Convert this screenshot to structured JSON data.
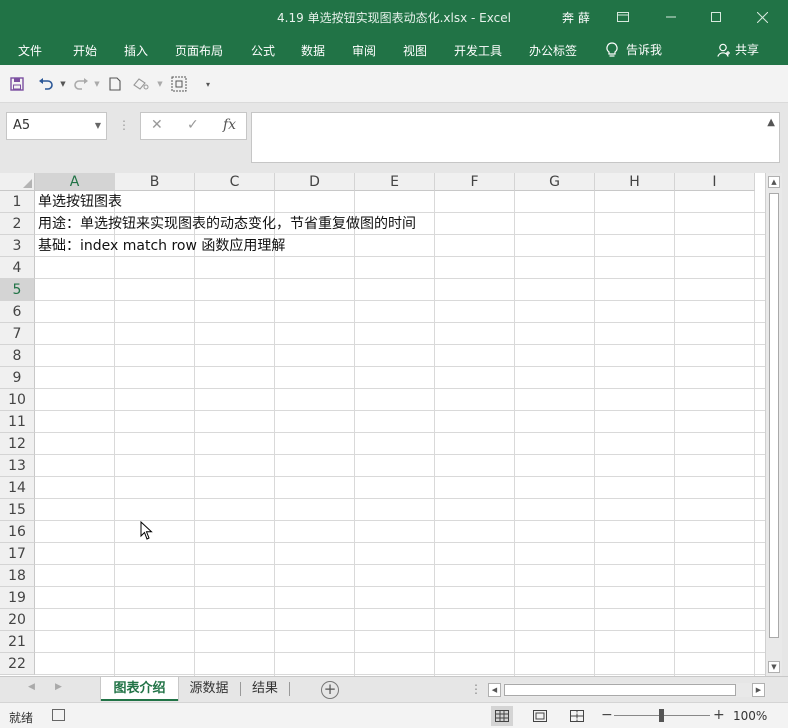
{
  "window": {
    "title": "4.19 单选按钮实现图表动态化.xlsx  -  Excel",
    "user": "奔 薛"
  },
  "ribbon": {
    "tabs": [
      "文件",
      "开始",
      "插入",
      "页面布局",
      "公式",
      "数据",
      "审阅",
      "视图",
      "开发工具",
      "办公标签"
    ],
    "tell_me": "告诉我",
    "share": "共享"
  },
  "formula_bar": {
    "name_box": "A5",
    "fx_label": "fx",
    "content": ""
  },
  "sheet": {
    "columns": [
      "A",
      "B",
      "C",
      "D",
      "E",
      "F",
      "G",
      "H",
      "I"
    ],
    "rows": [
      "1",
      "2",
      "3",
      "4",
      "5",
      "6",
      "7",
      "8",
      "9",
      "10",
      "11",
      "12",
      "13",
      "14",
      "15",
      "16",
      "17",
      "18",
      "19",
      "20",
      "21",
      "22"
    ],
    "active_row": "5",
    "active_column": "A",
    "cells": {
      "A1": "单选按钮图表",
      "A2": "用途：单选按钮来实现图表的动态变化，节省重复做图的时间",
      "A3": "基础：index match row 函数应用理解"
    }
  },
  "sheet_tabs": {
    "tabs": [
      "图表介绍",
      "源数据",
      "结果"
    ],
    "active": "图表介绍"
  },
  "status": {
    "ready": "就绪",
    "zoom": "100%"
  },
  "colors": {
    "brand": "#217346",
    "grid_line": "#d9d9d9",
    "header_bg": "#f0f0f0"
  }
}
